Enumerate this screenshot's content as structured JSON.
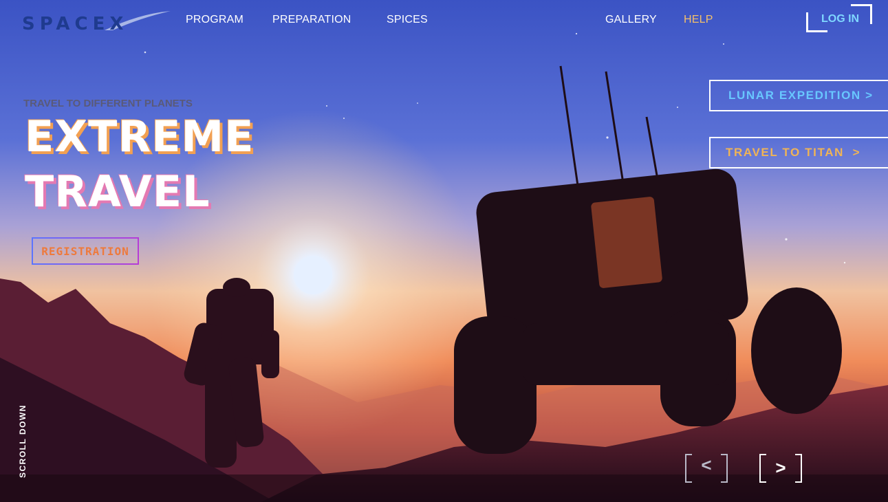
{
  "header": {
    "logo_text": "SPACEX",
    "nav": [
      "PROGRAM",
      "PREPARATION",
      "SPICES",
      "GALLERY",
      "HELP"
    ],
    "login_label": "LOG IN"
  },
  "side_buttons": [
    "LUNAR EXPEDITION >",
    "TRAVEL TO TITAN  >"
  ],
  "hero": {
    "kicker": "TRAVEL TO DIFFERENT PLANETS",
    "title_line1": "EXTREME",
    "title_line2": "TRAVEL",
    "cta_label": "REGISTRATION"
  },
  "scroll_label": "SCROLL DOWN",
  "slider": {
    "prev_label": "<",
    "next_label": ">"
  },
  "colors": {
    "nav_text": "#ffffff",
    "help_accent": "#f4c06a",
    "login_text": "#7fd7ff",
    "lunar_text": "#68c7ff",
    "titan_text": "#f0b455",
    "title_outline_1": "#f2a052",
    "title_outline_2": "#e47ab2",
    "cta_text": "#ee7a3c"
  },
  "icons": [
    "chevron-left-icon",
    "chevron-right-icon"
  ]
}
